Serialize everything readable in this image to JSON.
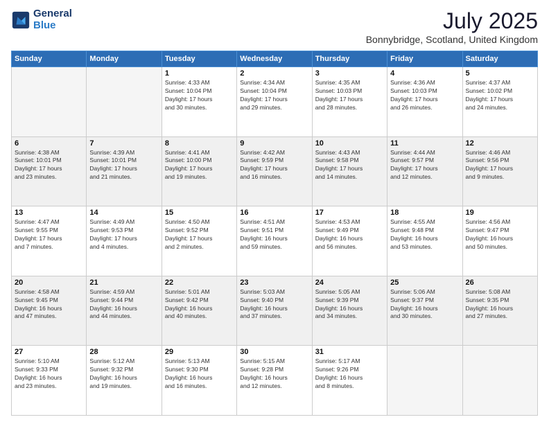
{
  "header": {
    "logo_line1": "General",
    "logo_line2": "Blue",
    "title": "July 2025",
    "subtitle": "Bonnybridge, Scotland, United Kingdom"
  },
  "weekdays": [
    "Sunday",
    "Monday",
    "Tuesday",
    "Wednesday",
    "Thursday",
    "Friday",
    "Saturday"
  ],
  "weeks": [
    [
      {
        "day": "",
        "info": ""
      },
      {
        "day": "",
        "info": ""
      },
      {
        "day": "1",
        "info": "Sunrise: 4:33 AM\nSunset: 10:04 PM\nDaylight: 17 hours\nand 30 minutes."
      },
      {
        "day": "2",
        "info": "Sunrise: 4:34 AM\nSunset: 10:04 PM\nDaylight: 17 hours\nand 29 minutes."
      },
      {
        "day": "3",
        "info": "Sunrise: 4:35 AM\nSunset: 10:03 PM\nDaylight: 17 hours\nand 28 minutes."
      },
      {
        "day": "4",
        "info": "Sunrise: 4:36 AM\nSunset: 10:03 PM\nDaylight: 17 hours\nand 26 minutes."
      },
      {
        "day": "5",
        "info": "Sunrise: 4:37 AM\nSunset: 10:02 PM\nDaylight: 17 hours\nand 24 minutes."
      }
    ],
    [
      {
        "day": "6",
        "info": "Sunrise: 4:38 AM\nSunset: 10:01 PM\nDaylight: 17 hours\nand 23 minutes."
      },
      {
        "day": "7",
        "info": "Sunrise: 4:39 AM\nSunset: 10:01 PM\nDaylight: 17 hours\nand 21 minutes."
      },
      {
        "day": "8",
        "info": "Sunrise: 4:41 AM\nSunset: 10:00 PM\nDaylight: 17 hours\nand 19 minutes."
      },
      {
        "day": "9",
        "info": "Sunrise: 4:42 AM\nSunset: 9:59 PM\nDaylight: 17 hours\nand 16 minutes."
      },
      {
        "day": "10",
        "info": "Sunrise: 4:43 AM\nSunset: 9:58 PM\nDaylight: 17 hours\nand 14 minutes."
      },
      {
        "day": "11",
        "info": "Sunrise: 4:44 AM\nSunset: 9:57 PM\nDaylight: 17 hours\nand 12 minutes."
      },
      {
        "day": "12",
        "info": "Sunrise: 4:46 AM\nSunset: 9:56 PM\nDaylight: 17 hours\nand 9 minutes."
      }
    ],
    [
      {
        "day": "13",
        "info": "Sunrise: 4:47 AM\nSunset: 9:55 PM\nDaylight: 17 hours\nand 7 minutes."
      },
      {
        "day": "14",
        "info": "Sunrise: 4:49 AM\nSunset: 9:53 PM\nDaylight: 17 hours\nand 4 minutes."
      },
      {
        "day": "15",
        "info": "Sunrise: 4:50 AM\nSunset: 9:52 PM\nDaylight: 17 hours\nand 2 minutes."
      },
      {
        "day": "16",
        "info": "Sunrise: 4:51 AM\nSunset: 9:51 PM\nDaylight: 16 hours\nand 59 minutes."
      },
      {
        "day": "17",
        "info": "Sunrise: 4:53 AM\nSunset: 9:49 PM\nDaylight: 16 hours\nand 56 minutes."
      },
      {
        "day": "18",
        "info": "Sunrise: 4:55 AM\nSunset: 9:48 PM\nDaylight: 16 hours\nand 53 minutes."
      },
      {
        "day": "19",
        "info": "Sunrise: 4:56 AM\nSunset: 9:47 PM\nDaylight: 16 hours\nand 50 minutes."
      }
    ],
    [
      {
        "day": "20",
        "info": "Sunrise: 4:58 AM\nSunset: 9:45 PM\nDaylight: 16 hours\nand 47 minutes."
      },
      {
        "day": "21",
        "info": "Sunrise: 4:59 AM\nSunset: 9:44 PM\nDaylight: 16 hours\nand 44 minutes."
      },
      {
        "day": "22",
        "info": "Sunrise: 5:01 AM\nSunset: 9:42 PM\nDaylight: 16 hours\nand 40 minutes."
      },
      {
        "day": "23",
        "info": "Sunrise: 5:03 AM\nSunset: 9:40 PM\nDaylight: 16 hours\nand 37 minutes."
      },
      {
        "day": "24",
        "info": "Sunrise: 5:05 AM\nSunset: 9:39 PM\nDaylight: 16 hours\nand 34 minutes."
      },
      {
        "day": "25",
        "info": "Sunrise: 5:06 AM\nSunset: 9:37 PM\nDaylight: 16 hours\nand 30 minutes."
      },
      {
        "day": "26",
        "info": "Sunrise: 5:08 AM\nSunset: 9:35 PM\nDaylight: 16 hours\nand 27 minutes."
      }
    ],
    [
      {
        "day": "27",
        "info": "Sunrise: 5:10 AM\nSunset: 9:33 PM\nDaylight: 16 hours\nand 23 minutes."
      },
      {
        "day": "28",
        "info": "Sunrise: 5:12 AM\nSunset: 9:32 PM\nDaylight: 16 hours\nand 19 minutes."
      },
      {
        "day": "29",
        "info": "Sunrise: 5:13 AM\nSunset: 9:30 PM\nDaylight: 16 hours\nand 16 minutes."
      },
      {
        "day": "30",
        "info": "Sunrise: 5:15 AM\nSunset: 9:28 PM\nDaylight: 16 hours\nand 12 minutes."
      },
      {
        "day": "31",
        "info": "Sunrise: 5:17 AM\nSunset: 9:26 PM\nDaylight: 16 hours\nand 8 minutes."
      },
      {
        "day": "",
        "info": ""
      },
      {
        "day": "",
        "info": ""
      }
    ]
  ]
}
